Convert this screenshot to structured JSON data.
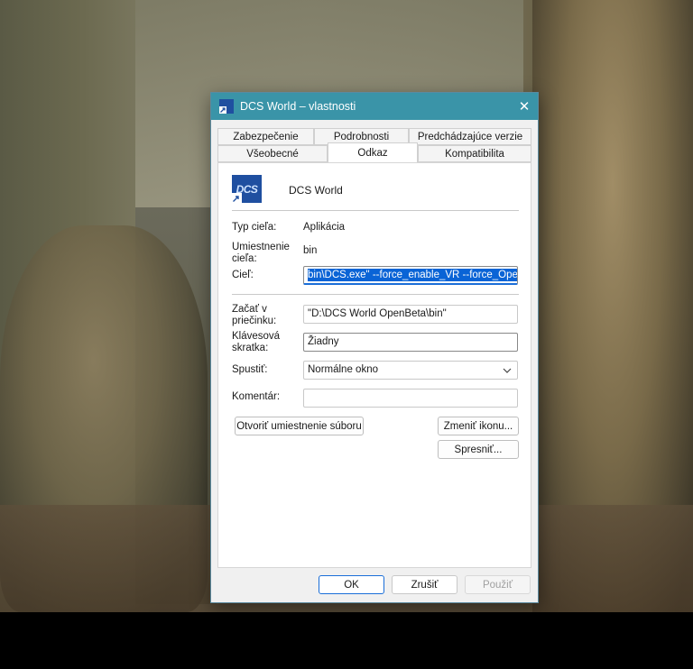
{
  "window": {
    "title": "DCS World – vlastnosti",
    "close_glyph": "✕"
  },
  "tabs": {
    "row1": [
      "Zabezpečenie",
      "Podrobnosti",
      "Predchádzajúce verzie"
    ],
    "row2": [
      "Všeobecné",
      "Odkaz",
      "Kompatibilita"
    ],
    "active": "Odkaz"
  },
  "shortcut": {
    "icon_text": "DCS",
    "app_name": "DCS World",
    "target_type_label": "Typ cieľa:",
    "target_type_value": "Aplikácia",
    "target_location_label": "Umiestnenie cieľa:",
    "target_location_value": "bin",
    "target_label": "Cieľ:",
    "target_value": "bin\\DCS.exe\" --force_enable_VR --force_OpenXR",
    "start_in_label": "Začať v priečinku:",
    "start_in_value": "\"D:\\DCS World OpenBeta\\bin\"",
    "hotkey_label": "Klávesová skratka:",
    "hotkey_value": "Žiadny",
    "run_label": "Spustiť:",
    "run_value": "Normálne okno",
    "comment_label": "Komentár:",
    "comment_value": "",
    "open_location_button": "Otvoriť umiestnenie súboru",
    "change_icon_button": "Zmeniť ikonu...",
    "advanced_button": "Spresniť..."
  },
  "footer": {
    "ok": "OK",
    "cancel": "Zrušiť",
    "apply": "Použiť"
  },
  "colors": {
    "titlebar": "#3a94a8",
    "accent": "#1a6ed8",
    "selection": "#0a64d6"
  }
}
